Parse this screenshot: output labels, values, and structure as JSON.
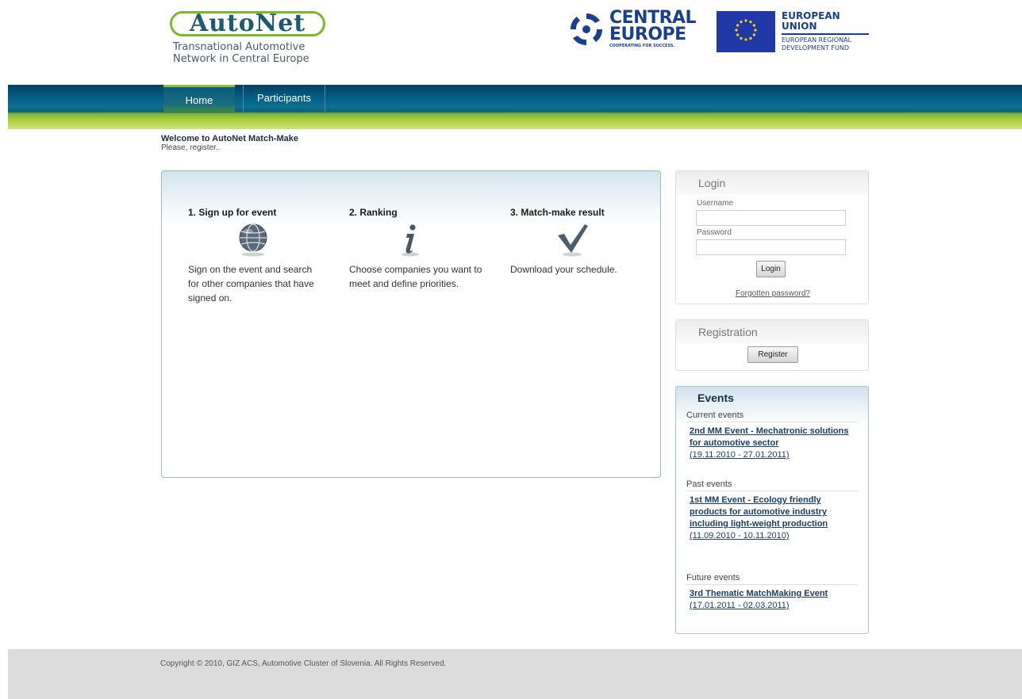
{
  "header": {
    "logo_word": "AutoNet",
    "logo_subtitle_line1": "Transnational Automotive",
    "logo_subtitle_line2": "Network in Central Europe",
    "ce_line1": "CENTRAL",
    "ce_line2": "EUROPE",
    "ce_tagline": "COOPERATING FOR SUCCESS.",
    "eu_line1": "EUROPEAN UNION",
    "eu_line2": "EUROPEAN REGIONAL",
    "eu_line3": "DEVELOPMENT FUND"
  },
  "nav": {
    "tabs": [
      {
        "label": "Home"
      },
      {
        "label": "Participants"
      }
    ]
  },
  "welcome": {
    "title": "Welcome to AutoNet Match-Make",
    "subtitle": "Please, register.."
  },
  "steps": [
    {
      "title": "1. Sign up for event",
      "icon": "globe-icon",
      "text": "Sign on the event and search for other companies that have signed on."
    },
    {
      "title": "2. Ranking",
      "icon": "info-icon",
      "text": "Choose companies you want to meet and define priorities."
    },
    {
      "title": "3. Match-make result",
      "icon": "checkmark-icon",
      "text": "Download your schedule."
    }
  ],
  "login": {
    "title": "Login",
    "username_label": "Username",
    "username_value": "",
    "password_label": "Password",
    "password_value": "",
    "button": "Login",
    "forgot": "Forgotten password?"
  },
  "registration": {
    "title": "Registration",
    "button": "Register"
  },
  "events": {
    "title": "Events",
    "current_label": "Current events",
    "current": {
      "name": "2nd MM Event - Mechatronic solutions for automotive sector",
      "dates": "(19.11.2010 - 27.01.2011)"
    },
    "past_label": "Past events",
    "past": {
      "name": "1st MM Event - Ecology friendly products for automotive industry including light-weight production",
      "dates": "(11.09.2010 - 10.11.2010)"
    },
    "future_label": "Future events",
    "future": {
      "name": "3rd Thematic MatchMaking Event",
      "dates": "(17.01.2011 - 02.03.2011)"
    }
  },
  "footer": {
    "copyright": "Copyright © 2010, GIZ ACS, Automotive Cluster of Slovenia. All Rights Reserved."
  },
  "colors": {
    "nav_dark": "#013f5f",
    "nav_green": "#a8cf3e",
    "brand_blue": "#1b3f8f",
    "logo_green": "#7cb82f"
  }
}
